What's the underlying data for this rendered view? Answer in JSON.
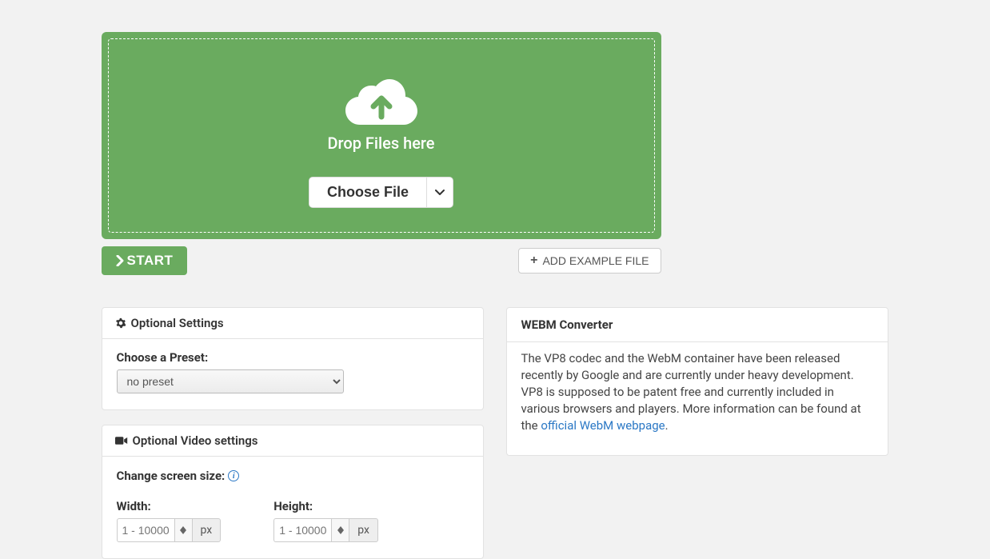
{
  "dropzone": {
    "label": "Drop Files here",
    "choose_file": "Choose File"
  },
  "actions": {
    "start": "START",
    "add_example": "ADD EXAMPLE FILE"
  },
  "optional_settings": {
    "title": "Optional Settings",
    "preset_label": "Choose a Preset:",
    "preset_value": "no preset"
  },
  "video_settings": {
    "title": "Optional Video settings",
    "screen_size_label": "Change screen size:",
    "width_label": "Width:",
    "height_label": "Height:",
    "placeholder": "1 - 10000",
    "unit": "px"
  },
  "info": {
    "title": "WEBM Converter",
    "body": "The VP8 codec and the WebM container have been released recently by Google and are currently under heavy development. VP8 is supposed to be patent free and currently included in various browsers and players. More information can be found at the ",
    "link_text": "official WebM webpage",
    "period": "."
  }
}
